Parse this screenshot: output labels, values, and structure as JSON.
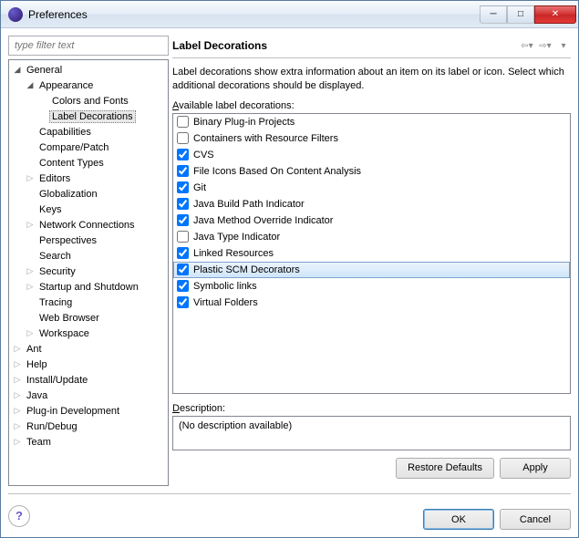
{
  "window": {
    "title": "Preferences"
  },
  "filter": {
    "placeholder": "type filter text"
  },
  "tree": [
    {
      "label": "General",
      "indent": 0,
      "twisty": "open",
      "children": true
    },
    {
      "label": "Appearance",
      "indent": 1,
      "twisty": "open",
      "children": true
    },
    {
      "label": "Colors and Fonts",
      "indent": 2,
      "twisty": "",
      "children": false
    },
    {
      "label": "Label Decorations",
      "indent": 2,
      "twisty": "",
      "children": false,
      "selected": true
    },
    {
      "label": "Capabilities",
      "indent": 1,
      "twisty": "",
      "children": false
    },
    {
      "label": "Compare/Patch",
      "indent": 1,
      "twisty": "",
      "children": false
    },
    {
      "label": "Content Types",
      "indent": 1,
      "twisty": "",
      "children": false
    },
    {
      "label": "Editors",
      "indent": 1,
      "twisty": "closed",
      "children": true
    },
    {
      "label": "Globalization",
      "indent": 1,
      "twisty": "",
      "children": false
    },
    {
      "label": "Keys",
      "indent": 1,
      "twisty": "",
      "children": false
    },
    {
      "label": "Network Connections",
      "indent": 1,
      "twisty": "closed",
      "children": true
    },
    {
      "label": "Perspectives",
      "indent": 1,
      "twisty": "",
      "children": false
    },
    {
      "label": "Search",
      "indent": 1,
      "twisty": "",
      "children": false
    },
    {
      "label": "Security",
      "indent": 1,
      "twisty": "closed",
      "children": true
    },
    {
      "label": "Startup and Shutdown",
      "indent": 1,
      "twisty": "closed",
      "children": true
    },
    {
      "label": "Tracing",
      "indent": 1,
      "twisty": "",
      "children": false
    },
    {
      "label": "Web Browser",
      "indent": 1,
      "twisty": "",
      "children": false
    },
    {
      "label": "Workspace",
      "indent": 1,
      "twisty": "closed",
      "children": true
    },
    {
      "label": "Ant",
      "indent": 0,
      "twisty": "closed",
      "children": true
    },
    {
      "label": "Help",
      "indent": 0,
      "twisty": "closed",
      "children": true
    },
    {
      "label": "Install/Update",
      "indent": 0,
      "twisty": "closed",
      "children": true
    },
    {
      "label": "Java",
      "indent": 0,
      "twisty": "closed",
      "children": true
    },
    {
      "label": "Plug-in Development",
      "indent": 0,
      "twisty": "closed",
      "children": true
    },
    {
      "label": "Run/Debug",
      "indent": 0,
      "twisty": "closed",
      "children": true
    },
    {
      "label": "Team",
      "indent": 0,
      "twisty": "closed",
      "children": true
    }
  ],
  "page": {
    "title": "Label Decorations",
    "intro": "Label decorations show extra information about an item on its label or icon. Select which additional decorations should be displayed.",
    "available_label": "vailable label decorations:",
    "available_mnemonic": "A",
    "description_label": "escription:",
    "description_mnemonic": "D",
    "description_text": "(No description available)"
  },
  "decorations": [
    {
      "label": "Binary Plug-in Projects",
      "checked": false
    },
    {
      "label": "Containers with Resource Filters",
      "checked": false
    },
    {
      "label": "CVS",
      "checked": true
    },
    {
      "label": "File Icons Based On Content Analysis",
      "checked": true
    },
    {
      "label": "Git",
      "checked": true
    },
    {
      "label": "Java Build Path Indicator",
      "checked": true
    },
    {
      "label": "Java Method Override Indicator",
      "checked": true
    },
    {
      "label": "Java Type Indicator",
      "checked": false
    },
    {
      "label": "Linked Resources",
      "checked": true
    },
    {
      "label": "Plastic SCM Decorators",
      "checked": true,
      "selected": true
    },
    {
      "label": "Symbolic links",
      "checked": true
    },
    {
      "label": "Virtual Folders",
      "checked": true
    }
  ],
  "buttons": {
    "restore_defaults": "Restore Defaults",
    "apply": "Apply",
    "ok": "OK",
    "cancel": "Cancel"
  }
}
